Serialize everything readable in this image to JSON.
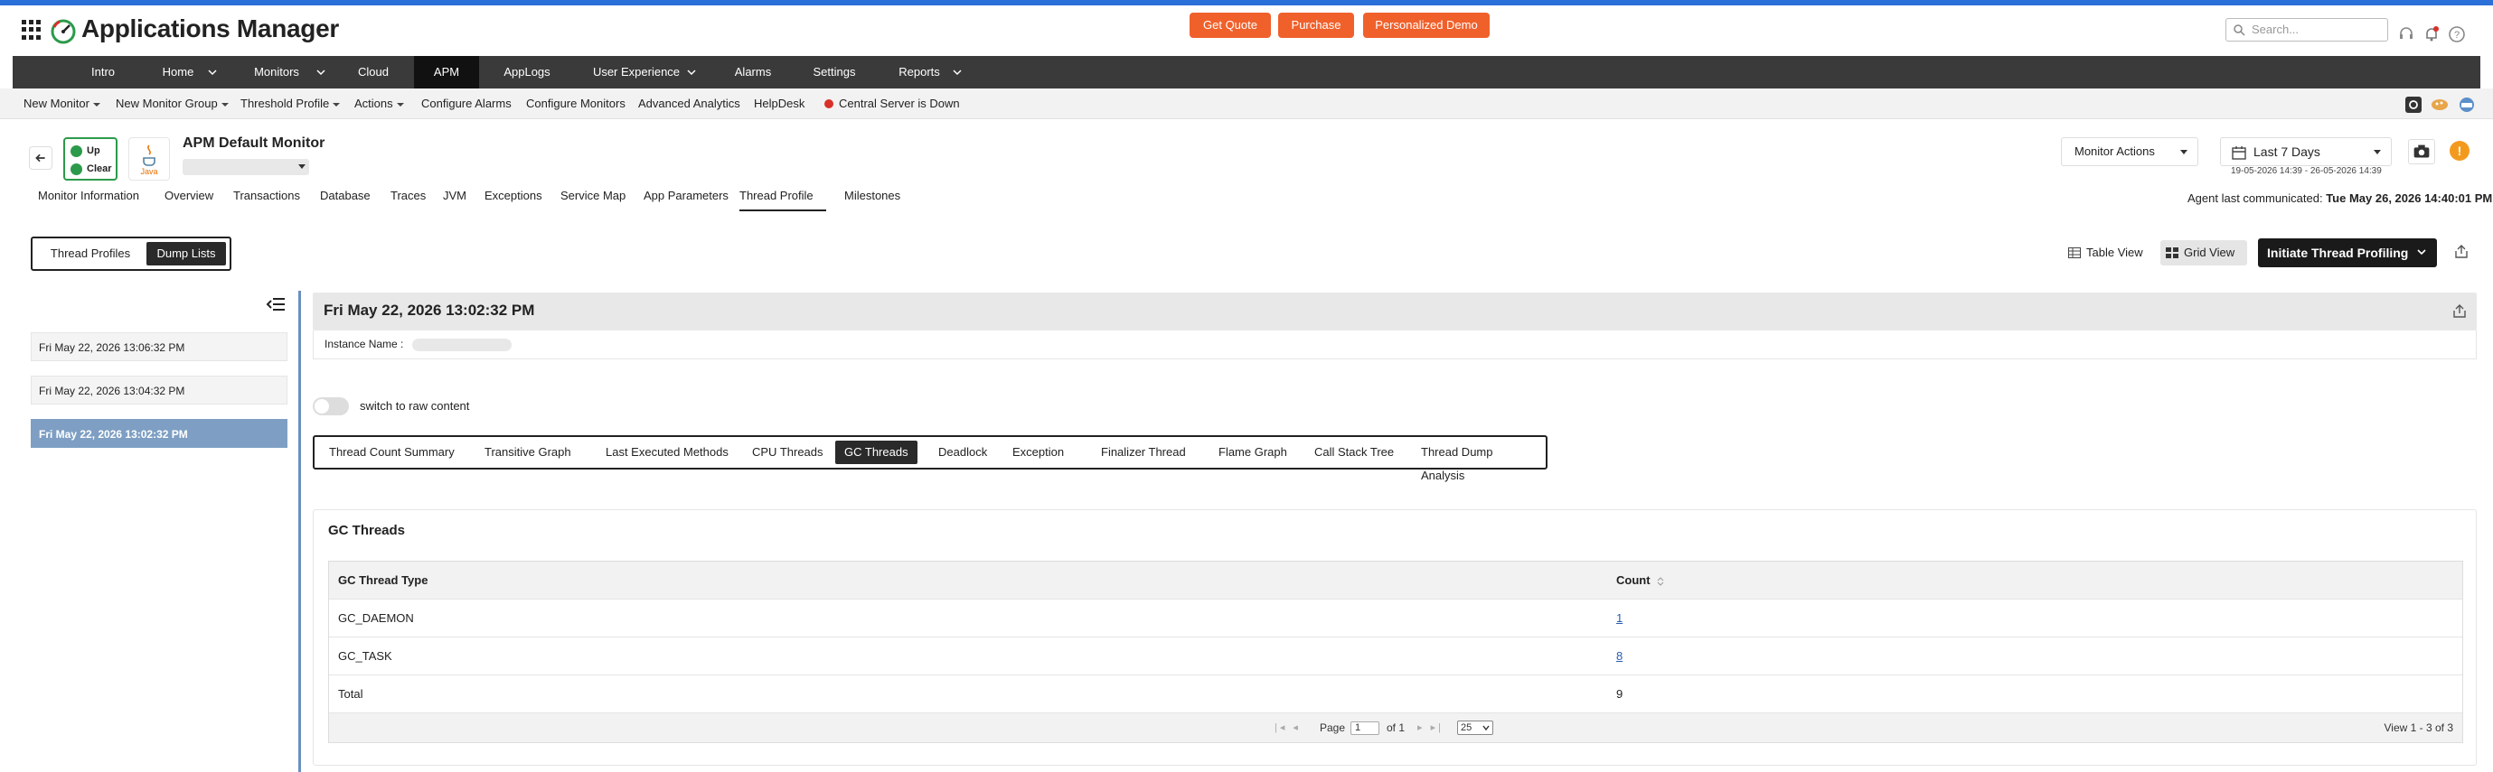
{
  "app": {
    "title": "Applications Manager",
    "buttons": {
      "get_quote": "Get Quote",
      "purchase": "Purchase",
      "demo": "Personalized Demo"
    },
    "search_placeholder": "Search...",
    "accent": "#f0602b",
    "nav_bg": "#3a3a3a"
  },
  "nav": {
    "items": [
      {
        "label": "Intro"
      },
      {
        "label": "Home"
      },
      {
        "label": "Monitors"
      },
      {
        "label": "Cloud"
      },
      {
        "label": "APM"
      },
      {
        "label": "AppLogs"
      },
      {
        "label": "User Experience"
      },
      {
        "label": "Alarms"
      },
      {
        "label": "Settings"
      },
      {
        "label": "Reports"
      }
    ],
    "active": "APM"
  },
  "subnav": {
    "items": [
      {
        "label": "New Monitor"
      },
      {
        "label": "New Monitor Group"
      },
      {
        "label": "Threshold Profile"
      },
      {
        "label": "Actions"
      },
      {
        "label": "Configure Alarms"
      },
      {
        "label": "Configure Monitors"
      },
      {
        "label": "Advanced Analytics"
      },
      {
        "label": "HelpDesk"
      },
      {
        "label": "Central Server is Down"
      }
    ]
  },
  "monitor": {
    "status_up": "Up",
    "status_clear": "Clear",
    "java_label": "Java",
    "title": "APM Default Monitor",
    "actions_label": "Monitor Actions",
    "period": "Last 7 Days",
    "period_range": "19-05-2026 14:39 - 26-05-2026 14:39",
    "warn": "!"
  },
  "tabs": {
    "items": [
      {
        "label": "Monitor Information"
      },
      {
        "label": "Overview"
      },
      {
        "label": "Transactions"
      },
      {
        "label": "Database"
      },
      {
        "label": "Traces"
      },
      {
        "label": "JVM"
      },
      {
        "label": "Exceptions"
      },
      {
        "label": "Service Map"
      },
      {
        "label": "App Parameters"
      },
      {
        "label": "Thread Profile"
      },
      {
        "label": "Milestones"
      }
    ],
    "active": "Thread Profile",
    "agent_label": "Agent last communicated:",
    "agent_time": "Tue May 26, 2026 14:40:01 PM"
  },
  "thread_profile": {
    "toggle": {
      "profiles": "Thread Profiles",
      "dumps": "Dump Lists"
    },
    "table_view": "Table View",
    "grid_view": "Grid View",
    "initiate": "Initiate Thread Profiling"
  },
  "dumps": {
    "items": [
      {
        "label": "Fri May 22, 2026 13:06:32 PM"
      },
      {
        "label": "Fri May 22, 2026 13:04:32 PM"
      },
      {
        "label": "Fri May 22, 2026 13:02:32 PM"
      }
    ],
    "selected": "Fri May 22, 2026 13:02:32 PM"
  },
  "dump_detail": {
    "title": "Fri May 22, 2026 13:02:32 PM",
    "instance_label": "Instance Name :",
    "raw_switch": "switch to raw content",
    "subtabs": [
      {
        "label": "Thread Count Summary"
      },
      {
        "label": "Transitive Graph"
      },
      {
        "label": "Last Executed Methods"
      },
      {
        "label": "CPU Threads"
      },
      {
        "label": "GC Threads"
      },
      {
        "label": "Deadlock"
      },
      {
        "label": "Exception"
      },
      {
        "label": "Finalizer Thread"
      },
      {
        "label": "Flame Graph"
      },
      {
        "label": "Call Stack Tree"
      },
      {
        "label": "Thread Dump Analysis"
      }
    ],
    "active_subtab": "GC Threads"
  },
  "gc_threads": {
    "title": "GC Threads",
    "headers": {
      "type": "GC Thread Type",
      "count": "Count"
    },
    "rows": [
      {
        "type": "GC_DAEMON",
        "count": "1"
      },
      {
        "type": "GC_TASK",
        "count": "8"
      },
      {
        "type": "Total",
        "count": "9"
      }
    ],
    "pager": {
      "page_label": "Page",
      "page": "1",
      "of_label": "of 1",
      "per_page": "25",
      "view_summary": "View 1 - 3 of 3"
    }
  }
}
